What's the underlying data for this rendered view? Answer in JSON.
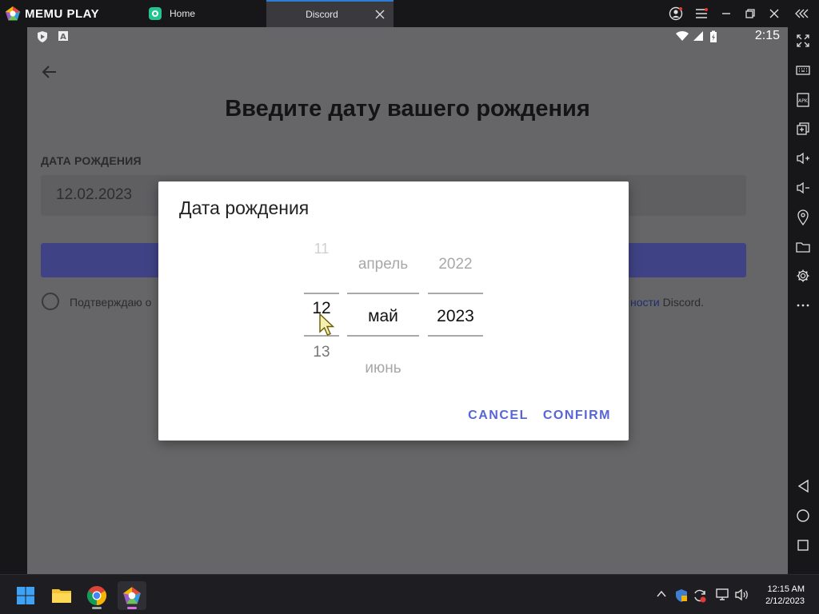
{
  "emulator": {
    "brand": "MEMU PLAY",
    "tabs": [
      {
        "label": "Home",
        "active": false
      },
      {
        "label": "Discord",
        "active": true
      }
    ]
  },
  "android": {
    "clock": "2:15"
  },
  "page": {
    "title": "Введите дату вашего рождения",
    "dob_label": "ДАТА РОЖДЕНИЯ",
    "dob_value": "12.02.2023",
    "agree_text_start": "Подтверждаю о",
    "agree_text_link": "ности",
    "agree_text_end": " Discord."
  },
  "dialog": {
    "title": "Дата рождения",
    "day": {
      "prev": "11",
      "current": "12",
      "next": "13"
    },
    "month": {
      "prev": "апрель",
      "current": "май",
      "next": "июнь"
    },
    "year": {
      "prev": "2022",
      "current": "2023",
      "next": ""
    },
    "cancel_label": "CANCEL",
    "confirm_label": "CONFIRM",
    "accent_color": "#5765d6"
  },
  "taskbar": {
    "apps": [
      "start-icon",
      "file-explorer-icon",
      "chrome-icon",
      "memu-icon"
    ],
    "time": "12:15 AM",
    "date": "2/12/2023"
  }
}
